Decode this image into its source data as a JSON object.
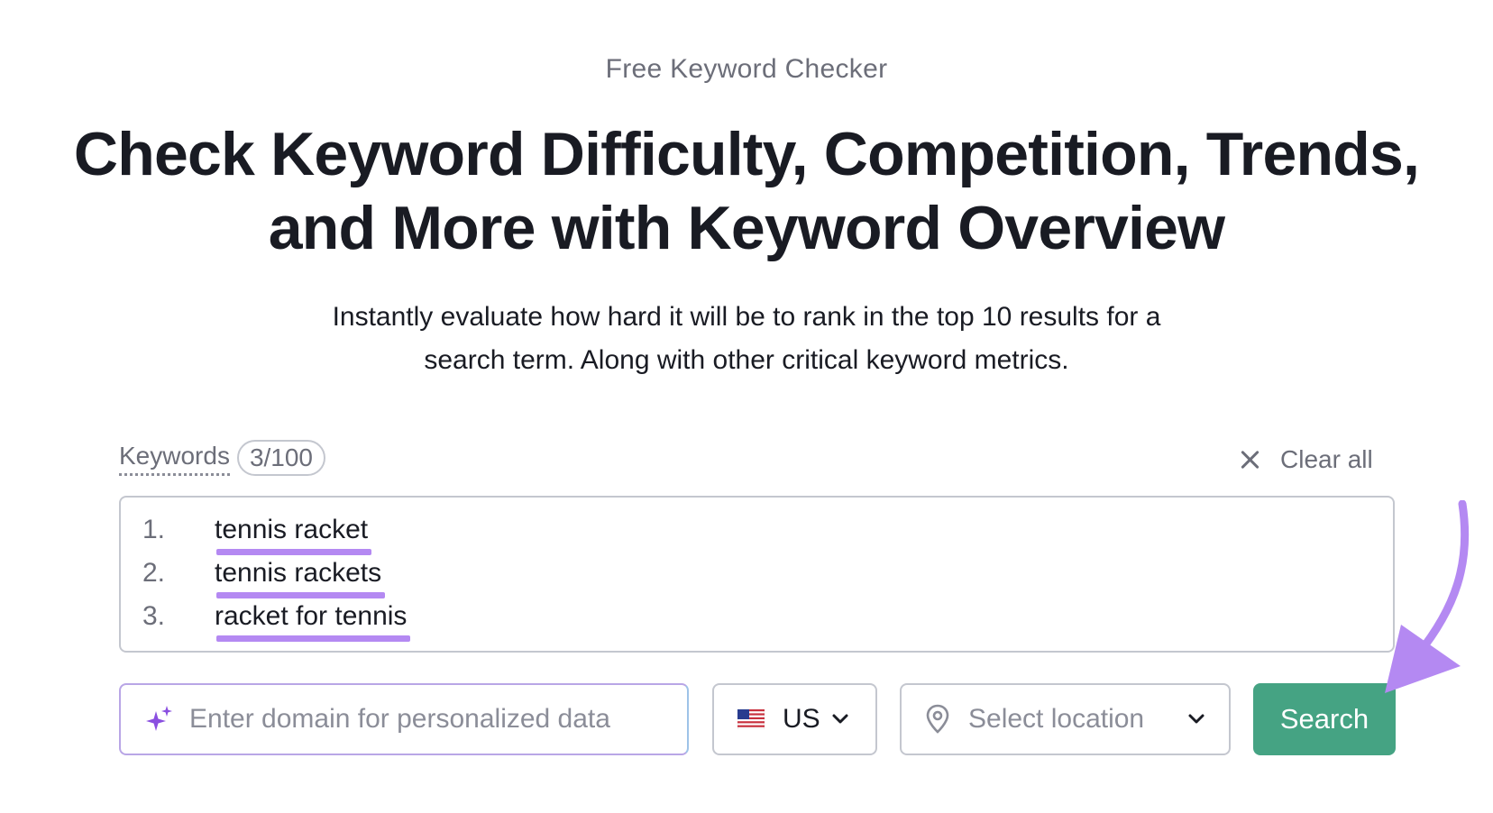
{
  "page": {
    "eyebrow": "Free Keyword Checker",
    "headline_line1": "Check Keyword Difficulty, Competition, Trends,",
    "headline_line2": "and More with Keyword Overview",
    "subtitle_line1": "Instantly evaluate how hard it will be to rank in the top 10 results for a",
    "subtitle_line2": "search term. Along with other critical keyword metrics."
  },
  "keywords": {
    "label": "Keywords",
    "count": "3/100",
    "clear_all_label": "Clear all",
    "items": [
      {
        "num": "1.",
        "text": "tennis racket"
      },
      {
        "num": "2.",
        "text": "tennis rackets"
      },
      {
        "num": "3.",
        "text": "racket for tennis"
      }
    ]
  },
  "controls": {
    "domain_placeholder": "Enter domain for personalized data",
    "country_code": "US",
    "location_placeholder": "Select location",
    "search_label": "Search"
  },
  "icons": {
    "sparkle": "sparkle-icon",
    "flag": "us-flag-icon",
    "pin": "location-pin-icon",
    "chevron": "chevron-down-icon",
    "close": "close-icon"
  },
  "colors": {
    "accent_green": "#45a383",
    "highlight_purple": "#b489f2",
    "sparkle_purple": "#8a4fe0",
    "text_dark": "#191b23",
    "text_muted": "#6c6e79"
  }
}
